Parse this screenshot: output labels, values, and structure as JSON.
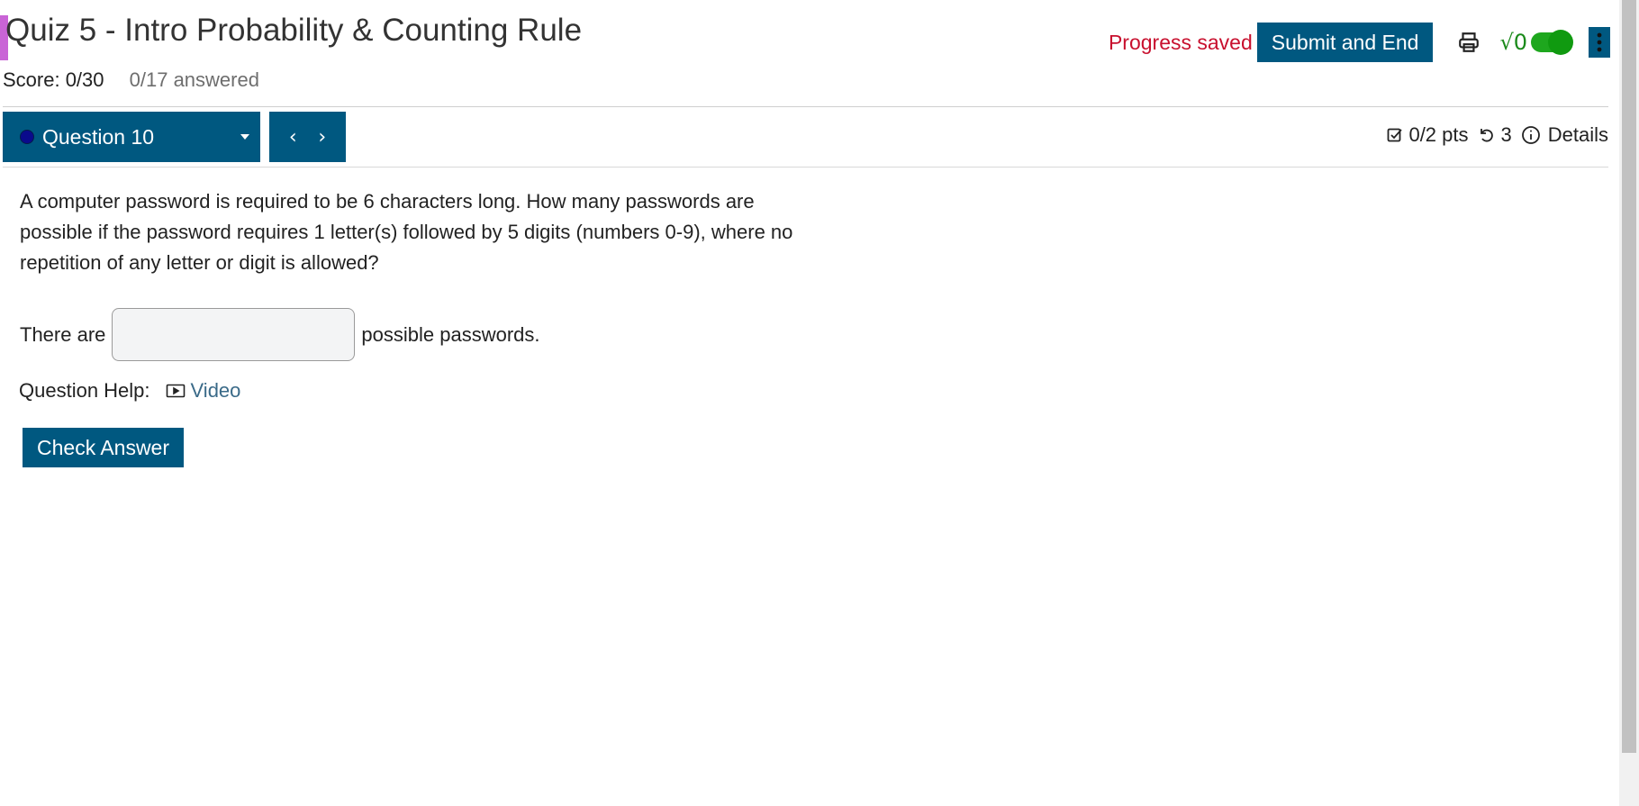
{
  "header": {
    "title": "Quiz 5 - Intro Probability & Counting Rule",
    "score": "Score: 0/30",
    "answered": "0/17 answered",
    "progress_status": "Progress saved",
    "submit_label": "Submit and End",
    "math_toggle_label": "√0",
    "math_toggle_on": true
  },
  "question_nav": {
    "selected_question": "Question 10",
    "prev_symbol": "‹",
    "next_symbol": "›"
  },
  "question_meta": {
    "points": "0/2 pts",
    "attempts": "3",
    "details_label": "Details"
  },
  "question": {
    "text": "A computer password is required to be 6 characters long. How many passwords are possible if the password requires 1 letter(s) followed by 5 digits (numbers 0-9), where no repetition of any letter or digit is allowed?",
    "answer_prefix": "There are",
    "answer_suffix": "possible passwords.",
    "answer_value": "",
    "help_label": "Question Help:",
    "video_label": "Video",
    "check_label": "Check Answer"
  },
  "colors": {
    "primary": "#005880",
    "progress_saved": "#c8102e",
    "toggle_green": "#1ea71e",
    "title_accent": "#c964d6"
  },
  "icons": [
    "print-icon",
    "sqrt-icon",
    "toggle-switch",
    "more-vertical-icon",
    "chevron-left-icon",
    "chevron-right-icon",
    "checkbox-icon",
    "retry-icon",
    "info-icon",
    "video-icon"
  ]
}
